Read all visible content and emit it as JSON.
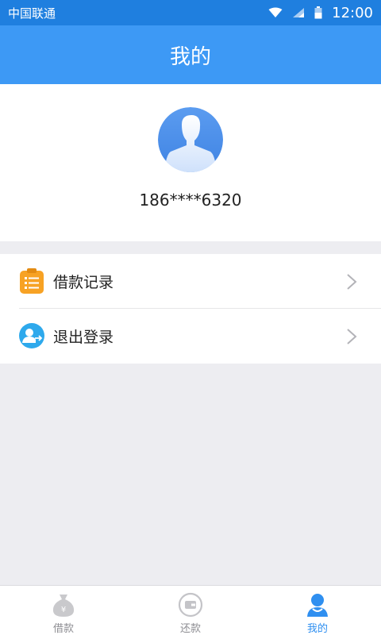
{
  "status_bar": {
    "carrier": "中国联通",
    "time": "12:00"
  },
  "header": {
    "title": "我的"
  },
  "profile": {
    "phone": "186****6320"
  },
  "menu": {
    "items": [
      {
        "label": "借款记录",
        "icon": "clipboard-icon"
      },
      {
        "label": "退出登录",
        "icon": "logout-user-icon"
      }
    ]
  },
  "tabs": [
    {
      "label": "借款",
      "icon": "money-bag-icon",
      "active": false
    },
    {
      "label": "还款",
      "icon": "wallet-icon",
      "active": false
    },
    {
      "label": "我的",
      "icon": "user-icon",
      "active": true
    }
  ],
  "colors": {
    "header": "#3d99f5",
    "status_bar": "#1f7fdf",
    "active_tab": "#2f8ff0",
    "background": "#ededf1"
  }
}
